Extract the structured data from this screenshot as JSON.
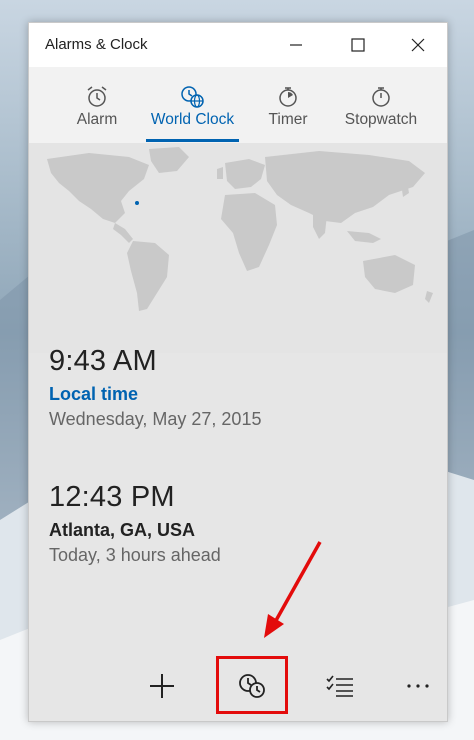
{
  "window": {
    "title": "Alarms & Clock"
  },
  "tabs": [
    {
      "label": "Alarm",
      "icon": "alarm-clock-icon"
    },
    {
      "label": "World Clock",
      "icon": "world-clock-icon",
      "active": true
    },
    {
      "label": "Timer",
      "icon": "timer-icon"
    },
    {
      "label": "Stopwatch",
      "icon": "stopwatch-icon"
    }
  ],
  "clocks": [
    {
      "time": "9:43 AM",
      "name": "Local time",
      "detail": "Wednesday, May 27, 2015"
    },
    {
      "time": "12:43 PM",
      "name": "Atlanta, GA, USA",
      "detail": "Today, 3 hours ahead"
    }
  ],
  "commands": {
    "add": {
      "icon": "add-icon"
    },
    "compare": {
      "icon": "compare-clocks-icon"
    },
    "select": {
      "icon": "select-list-icon"
    },
    "more": {
      "icon": "more-icon"
    }
  },
  "colors": {
    "accent": "#0063b1",
    "annotation": "#e30b0b"
  }
}
